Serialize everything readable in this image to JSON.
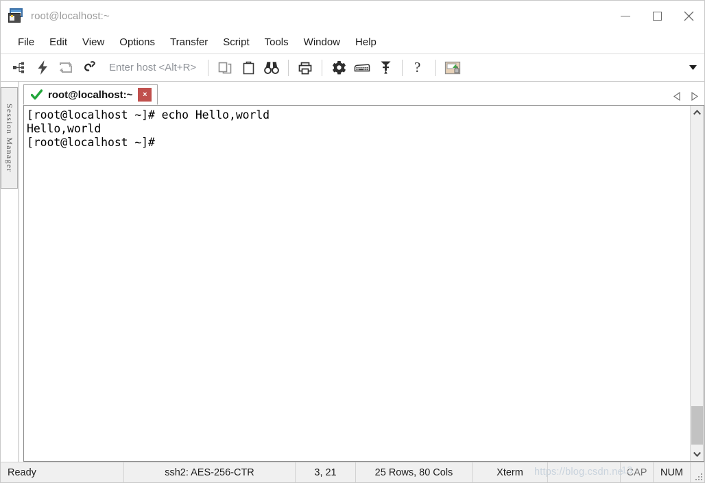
{
  "window": {
    "title": "root@localhost:~",
    "app_icon": "securecrt-icon",
    "controls": {
      "minimize": "minimize-button",
      "maximize": "maximize-button",
      "close": "close-button"
    }
  },
  "menubar": {
    "items": [
      {
        "label": "File",
        "name": "menu-file"
      },
      {
        "label": "Edit",
        "name": "menu-edit"
      },
      {
        "label": "View",
        "name": "menu-view"
      },
      {
        "label": "Options",
        "name": "menu-options"
      },
      {
        "label": "Transfer",
        "name": "menu-transfer"
      },
      {
        "label": "Script",
        "name": "menu-script"
      },
      {
        "label": "Tools",
        "name": "menu-tools"
      },
      {
        "label": "Window",
        "name": "menu-window"
      },
      {
        "label": "Help",
        "name": "menu-help"
      }
    ]
  },
  "toolbar": {
    "host_entry_placeholder": "Enter host <Alt+R>",
    "buttons": [
      {
        "name": "session-manager-icon",
        "title": "Session Manager"
      },
      {
        "name": "quick-connect-icon",
        "title": "Quick Connect"
      },
      {
        "name": "reconnect-icon",
        "title": "Reconnect"
      },
      {
        "name": "clone-session-icon",
        "title": "Clone Session"
      },
      {
        "name": "copy-icon",
        "title": "Copy"
      },
      {
        "name": "paste-icon",
        "title": "Paste"
      },
      {
        "name": "find-icon",
        "title": "Find"
      },
      {
        "name": "print-icon",
        "title": "Print"
      },
      {
        "name": "session-options-icon",
        "title": "Session Options"
      },
      {
        "name": "keymap-editor-icon",
        "title": "Keymap Editor"
      },
      {
        "name": "key-icon",
        "title": "Manage Keys"
      },
      {
        "name": "help-icon",
        "title": "Help"
      },
      {
        "name": "secure-lock-icon",
        "title": "Secure Shell"
      }
    ],
    "overflow": "toolbar-overflow-chevron"
  },
  "sidebar": {
    "panel_label": "Session Manager"
  },
  "tabbar": {
    "tabs": [
      {
        "label": "root@localhost:~",
        "status_icon": "green-check-icon",
        "close_label": "×",
        "active": true
      }
    ],
    "nav_prev": "tab-scroll-left",
    "nav_next": "tab-scroll-right"
  },
  "terminal": {
    "lines": [
      "[root@localhost ~]# echo Hello,world",
      "Hello,world",
      "[root@localhost ~]#"
    ]
  },
  "scrollbar": {
    "up_arrow": "scroll-up-arrow",
    "down_arrow": "scroll-down-arrow"
  },
  "statusbar": {
    "ready": "Ready",
    "cipher": "ssh2: AES-256-CTR",
    "cursor_position": "3, 21",
    "dimensions": "25 Rows, 80 Cols",
    "emulation": "Xterm",
    "caps": "CAP",
    "num": "NUM",
    "watermark": "https://blog.csdn.ne",
    "watermark2": "13"
  },
  "colors": {
    "accent_blue": "#3a6ea5",
    "close_red": "#c0504d",
    "check_green": "#22a63b",
    "status_bg": "#f0f0f0",
    "terminal_bg": "#ffffff",
    "terminal_fg": "#000000"
  }
}
